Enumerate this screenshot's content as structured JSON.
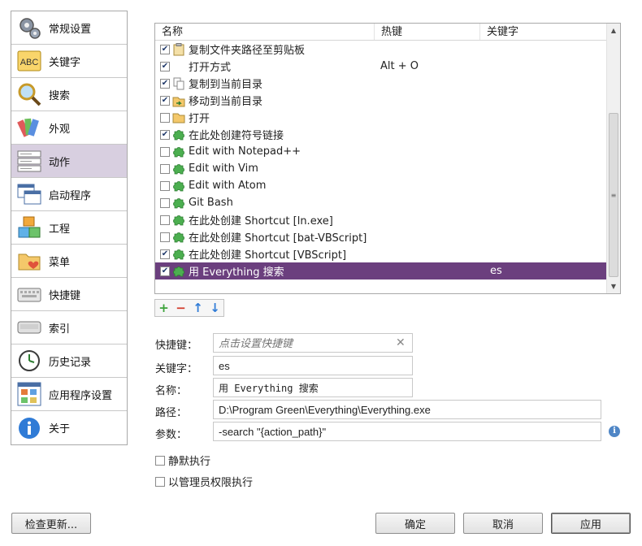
{
  "sidebar": {
    "items": [
      {
        "label": "常规设置",
        "icon": "gears-icon"
      },
      {
        "label": "关键字",
        "icon": "abc-icon"
      },
      {
        "label": "搜索",
        "icon": "magnifier-icon"
      },
      {
        "label": "外观",
        "icon": "palette-icon"
      },
      {
        "label": "动作",
        "icon": "action-list-icon",
        "active": true
      },
      {
        "label": "启动程序",
        "icon": "windows-icon"
      },
      {
        "label": "工程",
        "icon": "blocks-icon"
      },
      {
        "label": "菜单",
        "icon": "folder-heart-icon"
      },
      {
        "label": "快捷键",
        "icon": "keyboard-icon"
      },
      {
        "label": "索引",
        "icon": "keyboard-key-icon"
      },
      {
        "label": "历史记录",
        "icon": "clock-icon"
      },
      {
        "label": "应用程序设置",
        "icon": "app-grid-icon"
      },
      {
        "label": "关于",
        "icon": "info-icon"
      }
    ]
  },
  "list": {
    "headers": {
      "name": "名称",
      "hotkey": "热键",
      "keyword": "关键字"
    },
    "rows": [
      {
        "checked": true,
        "icon": "clipboard-icon",
        "name": "复制文件夹路径至剪贴板",
        "hotkey": "",
        "keyword": ""
      },
      {
        "checked": true,
        "icon": "",
        "name": "打开方式",
        "hotkey": "Alt + O",
        "keyword": ""
      },
      {
        "checked": true,
        "icon": "copy-icon",
        "name": "复制到当前目录",
        "hotkey": "",
        "keyword": ""
      },
      {
        "checked": true,
        "icon": "move-icon",
        "name": "移动到当前目录",
        "hotkey": "",
        "keyword": ""
      },
      {
        "checked": false,
        "icon": "folder-icon",
        "name": "打开",
        "hotkey": "",
        "keyword": ""
      },
      {
        "checked": true,
        "icon": "puzzle-icon",
        "name": "在此处创建符号链接",
        "hotkey": "",
        "keyword": ""
      },
      {
        "checked": false,
        "icon": "puzzle-icon",
        "name": "Edit with Notepad++",
        "hotkey": "",
        "keyword": ""
      },
      {
        "checked": false,
        "icon": "puzzle-icon",
        "name": "Edit with Vim",
        "hotkey": "",
        "keyword": ""
      },
      {
        "checked": false,
        "icon": "puzzle-icon",
        "name": "Edit with Atom",
        "hotkey": "",
        "keyword": ""
      },
      {
        "checked": false,
        "icon": "puzzle-icon",
        "name": "Git Bash",
        "hotkey": "",
        "keyword": ""
      },
      {
        "checked": false,
        "icon": "puzzle-icon",
        "name": "在此处创建 Shortcut [ln.exe]",
        "hotkey": "",
        "keyword": ""
      },
      {
        "checked": false,
        "icon": "puzzle-icon",
        "name": "在此处创建 Shortcut [bat-VBScript]",
        "hotkey": "",
        "keyword": ""
      },
      {
        "checked": true,
        "icon": "puzzle-icon",
        "name": "在此处创建 Shortcut [VBScript]",
        "hotkey": "",
        "keyword": ""
      },
      {
        "checked": true,
        "icon": "puzzle-icon",
        "name": "用 Everything 搜索",
        "hotkey": "",
        "keyword": "es",
        "selected": true
      }
    ]
  },
  "toolbar": {
    "add": "+",
    "remove": "−",
    "up": "↑",
    "down": "↓"
  },
  "form": {
    "hotkey_label": "快捷键：",
    "hotkey_placeholder": "点击设置快捷键",
    "keyword_label": "关键字：",
    "keyword_value": "es",
    "name_label": "名称：",
    "name_value": "用 Everything 搜索",
    "path_label": "路径：",
    "path_value": "D:\\Program Green\\Everything\\Everything.exe",
    "params_label": "参数：",
    "params_value": "-search \"{action_path}\"",
    "silent_label": "静默执行",
    "admin_label": "以管理员权限执行"
  },
  "buttons": {
    "check_update": "检查更新...",
    "ok": "确定",
    "cancel": "取消",
    "apply": "应用"
  },
  "colors": {
    "selection": "#6b3f7e",
    "sidebar_active": "#d8cfe0"
  }
}
